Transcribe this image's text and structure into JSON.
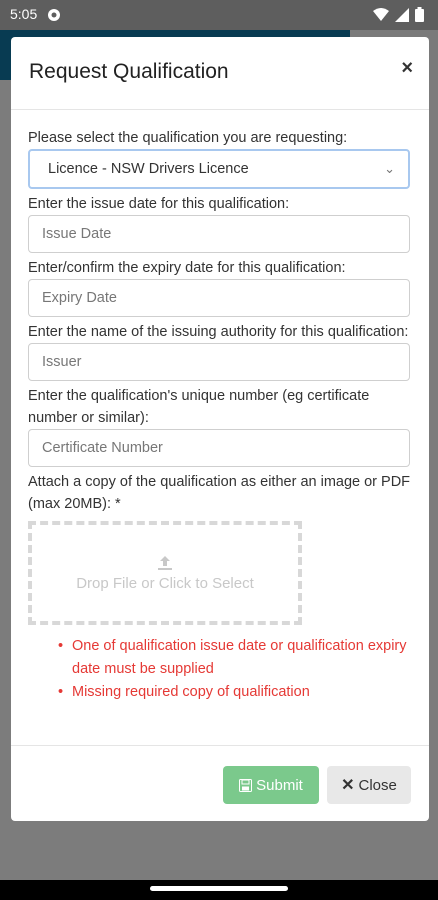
{
  "status": {
    "time": "5:05"
  },
  "modal": {
    "title": "Request Qualification",
    "close_symbol": "×"
  },
  "form": {
    "qualification_label": "Please select the qualification you are requesting:",
    "qualification_value": "Licence - NSW Drivers Licence",
    "issue_label": "Enter the issue date for this qualification:",
    "issue_placeholder": "Issue Date",
    "expiry_label": "Enter/confirm the expiry date for this qualification:",
    "expiry_placeholder": "Expiry Date",
    "issuer_label": "Enter the name of the issuing authority for this qualification:",
    "issuer_placeholder": "Issuer",
    "number_label": "Enter the qualification's unique number (eg certificate number or similar):",
    "number_placeholder": "Certificate Number",
    "attach_label": "Attach a copy of the qualification as either an image or PDF (max 20MB): *",
    "dropzone_text": "Drop File or Click to Select"
  },
  "errors": [
    "One of qualification issue date or qualification expiry date must be supplied",
    "Missing required copy of qualification"
  ],
  "footer": {
    "submit_label": "Submit",
    "close_label": "Close"
  },
  "colors": {
    "header": "#083b52",
    "submit": "#7bc98c",
    "error": "#e53935"
  }
}
